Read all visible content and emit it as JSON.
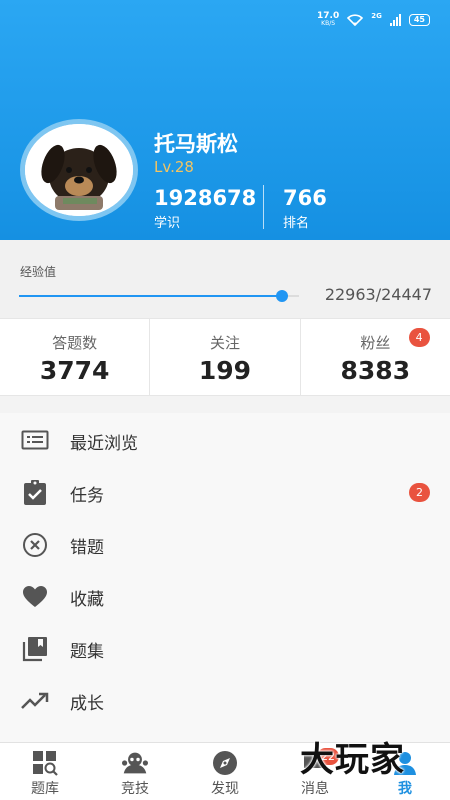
{
  "status_bar": {
    "speed": "17.0",
    "speed_unit": "KB/S",
    "network": "2G",
    "battery": "45"
  },
  "profile": {
    "name": "托马斯松",
    "level": "Lv.28",
    "knowledge_value": "1928678",
    "knowledge_label": "学识",
    "rank_value": "766",
    "rank_label": "排名"
  },
  "experience": {
    "label": "经验值",
    "value_text": "22963/24447",
    "progress": 0.939
  },
  "stats": [
    {
      "label": "答题数",
      "value": "3774"
    },
    {
      "label": "关注",
      "value": "199"
    },
    {
      "label": "粉丝",
      "value": "8383",
      "badge": "4"
    }
  ],
  "menu": [
    {
      "label": "最近浏览",
      "icon": "history-list-icon"
    },
    {
      "label": "任务",
      "icon": "clipboard-check-icon",
      "badge": "2"
    },
    {
      "label": "错题",
      "icon": "circle-x-icon"
    },
    {
      "label": "收藏",
      "icon": "heart-icon"
    },
    {
      "label": "题集",
      "icon": "collection-icon"
    },
    {
      "label": "成长",
      "icon": "trending-up-icon"
    }
  ],
  "tabs": [
    {
      "label": "题库",
      "icon": "grid-search-icon"
    },
    {
      "label": "竞技",
      "icon": "arena-icon"
    },
    {
      "label": "发现",
      "icon": "compass-icon"
    },
    {
      "label": "消息",
      "icon": "message-icon",
      "badge": "22"
    },
    {
      "label": "我",
      "icon": "profile-icon",
      "active": true
    }
  ],
  "watermark": "大玩家",
  "colors": {
    "header": "#1e9cee",
    "accent": "#2196f3",
    "badge": "#e9533f",
    "level": "#f2c462"
  }
}
